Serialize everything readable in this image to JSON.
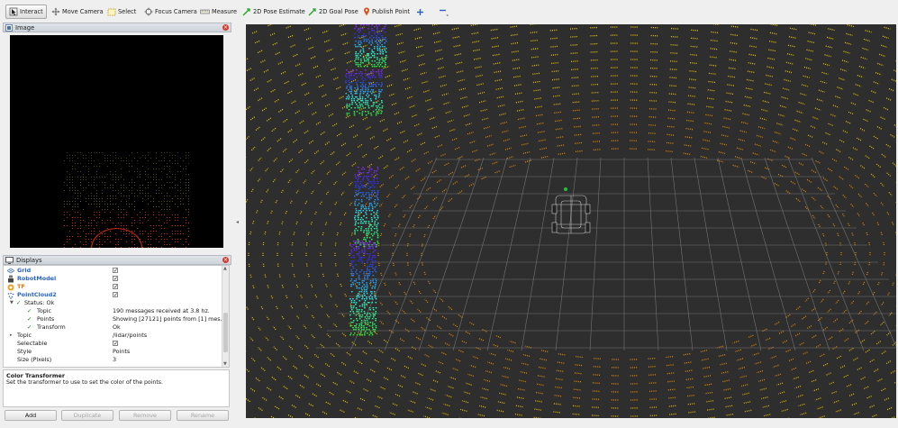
{
  "toolbar": {
    "items": [
      {
        "label": "Interact",
        "icon": "cursor-icon",
        "active": true
      },
      {
        "label": "Move Camera",
        "icon": "move-camera-icon"
      },
      {
        "label": "Select",
        "icon": "select-box-icon"
      },
      {
        "label": "Focus Camera",
        "icon": "focus-camera-icon"
      },
      {
        "label": "Measure",
        "icon": "ruler-icon"
      },
      {
        "label": "2D Pose Estimate",
        "icon": "green-arrow-icon"
      },
      {
        "label": "2D Goal Pose",
        "icon": "green-arrow-icon"
      },
      {
        "label": "Publish Point",
        "icon": "map-pin-icon"
      },
      {
        "label": "",
        "icon": "plus-icon"
      },
      {
        "label": "",
        "icon": "minus-icon"
      }
    ]
  },
  "image_panel": {
    "title": "Image",
    "close": "×"
  },
  "displays_panel": {
    "title": "Displays",
    "close": "×",
    "rows": [
      {
        "label": "Grid",
        "checked": "✓"
      },
      {
        "label": "RobotModel",
        "checked": "✓"
      },
      {
        "label": "TF",
        "checked": "✓"
      },
      {
        "label": "PointCloud2",
        "checked": "✓"
      },
      {
        "label": "Status: Ok"
      },
      {
        "label": "Topic",
        "value": "190 messages received at 3.8 hz."
      },
      {
        "label": "Points",
        "value": "Showing [27121] points from [1] mes..."
      },
      {
        "label": "Transform",
        "value": "Ok"
      },
      {
        "label": "Topic",
        "value": "/lidar/points"
      },
      {
        "label": "Selectable",
        "checked": "✓"
      },
      {
        "label": "Style",
        "value": "Points"
      },
      {
        "label": "Size (Pixels)",
        "value": "3"
      }
    ]
  },
  "description": {
    "title": "Color Transformer",
    "text": "Set the transformer to use to set the color of the points."
  },
  "buttons": {
    "add": "Add",
    "duplicate": "Duplicate",
    "remove": "Remove",
    "rename": "Rename"
  },
  "colors": {
    "accent_blue": "#2a63c4",
    "tf_orange": "#e07a10",
    "view_bg": "#2e2e2e",
    "grid": "#8a8a8a",
    "cloud_yellow": "#e8e000"
  }
}
